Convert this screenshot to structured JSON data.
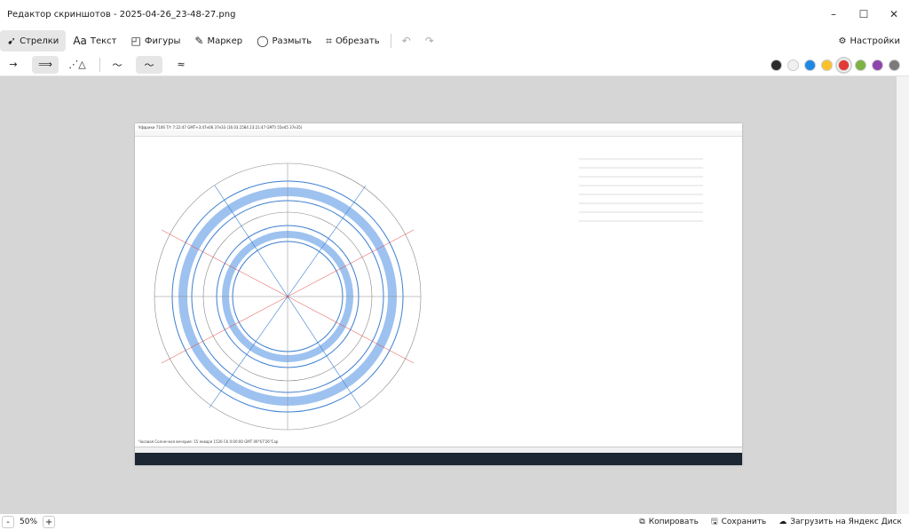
{
  "window": {
    "title": "Редактор скриншотов - 2025-04-26_23-48-27.png"
  },
  "toolbar": {
    "tools": [
      {
        "icon": "arrow-icon",
        "label": "Стрелки",
        "active": true
      },
      {
        "icon": "text-icon",
        "label": "Текст",
        "glyph": "Aa"
      },
      {
        "icon": "shapes-icon",
        "label": "Фигуры"
      },
      {
        "icon": "marker-icon",
        "label": "Маркер"
      },
      {
        "icon": "blur-icon",
        "label": "Размыть"
      },
      {
        "icon": "crop-icon",
        "label": "Обрезать"
      }
    ],
    "settings_label": "Настройки"
  },
  "colors": [
    "#2b2b2b",
    "#f0f0f0",
    "#1e88e5",
    "#fbc02d",
    "#e53935",
    "#7cb342",
    "#8e44ad",
    "#7a7a7a"
  ],
  "selected_color": "#e53935",
  "image": {
    "window_title": "Уфарихи 7106  Т/т  7:22:47 GMT+3:47н06 37е33 (16.03.1584 23:21:47 GMT) 55е45 37е35)",
    "caption": "Часовая Солнечная вечерия: 15 января 1526 Сб 0:00:00 GMT 09°67'26\"Cap"
  },
  "zoom": {
    "value": "50%",
    "minus": "-",
    "plus": "+"
  },
  "actions": [
    {
      "icon": "copy-icon",
      "label": "Копировать"
    },
    {
      "icon": "save-icon",
      "label": "Сохранить"
    },
    {
      "icon": "disk-icon",
      "label": "Загрузить на Яндекс Диск"
    }
  ]
}
